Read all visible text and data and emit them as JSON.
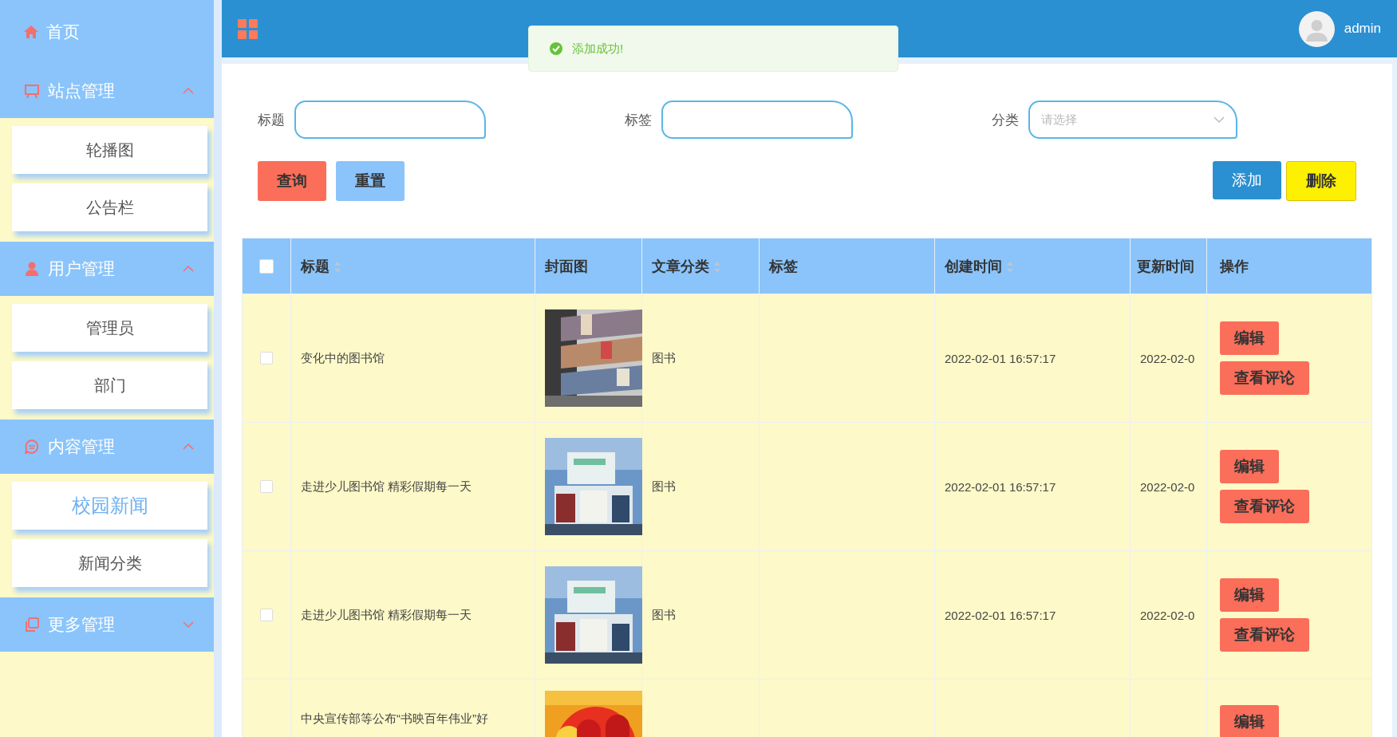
{
  "sidebar": {
    "home": {
      "label": "首页"
    },
    "groups": [
      {
        "label": "站点管理",
        "expanded": true,
        "items": [
          {
            "label": "轮播图",
            "selected": false
          },
          {
            "label": "公告栏",
            "selected": false
          }
        ]
      },
      {
        "label": "用户管理",
        "expanded": true,
        "items": [
          {
            "label": "管理员",
            "selected": false
          },
          {
            "label": "部门",
            "selected": false
          }
        ]
      },
      {
        "label": "内容管理",
        "expanded": true,
        "items": [
          {
            "label": "校园新闻",
            "selected": true
          },
          {
            "label": "新闻分类",
            "selected": false
          }
        ]
      },
      {
        "label": "更多管理",
        "expanded": false
      }
    ]
  },
  "header": {
    "user": "admin"
  },
  "toast": {
    "message": "添加成功!"
  },
  "filters": [
    {
      "label": "标题",
      "kind": "input"
    },
    {
      "label": "标签",
      "kind": "input"
    },
    {
      "label": "分类",
      "kind": "select",
      "placeholder": "请选择"
    }
  ],
  "buttons_left": [
    {
      "label": "查询",
      "kind": "primary"
    },
    {
      "label": "重置",
      "kind": "plain"
    }
  ],
  "buttons_right": [
    {
      "label": "添加",
      "kind": "add"
    },
    {
      "label": "删除",
      "kind": "delete"
    }
  ],
  "table": {
    "select_all": {
      "checked": false
    },
    "columns": [
      {
        "label": "标题",
        "sortable": true
      },
      {
        "label": "封面图",
        "sortable": false
      },
      {
        "label": "文章分类",
        "sortable": true
      },
      {
        "label": "标签",
        "sortable": false
      },
      {
        "label": "创建时间",
        "sortable": true
      },
      {
        "label": "更新时间",
        "sortable": false
      },
      {
        "label": "操作",
        "sortable": false
      }
    ],
    "rows": [
      {
        "checked": false,
        "title": "变化中的图书馆",
        "cover": {
          "kind": "picture"
        },
        "category": "图书",
        "created": "2022-02-01 16:57:17",
        "updated": "2022-02-0",
        "actions": [
          "编辑",
          "查看评论"
        ]
      },
      {
        "checked": false,
        "title": "走进少儿图书馆 精彩假期每一天",
        "cover": {
          "kind": "picture"
        },
        "category": "图书",
        "created": "2022-02-01 16:57:17",
        "updated": "2022-02-0",
        "actions": [
          "编辑",
          "查看评论"
        ]
      },
      {
        "checked": false,
        "title": "走进少儿图书馆 精彩假期每一天",
        "cover": {
          "kind": "picture"
        },
        "category": "图书",
        "created": "2022-02-01 16:57:17",
        "updated": "2022-02-0",
        "actions": [
          "编辑",
          "查看评论"
        ]
      },
      {
        "title": "中央宣传部等公布“书映百年伟业”好",
        "cover": {
          "kind": "picture"
        },
        "actions": [
          "编辑"
        ]
      }
    ]
  }
}
